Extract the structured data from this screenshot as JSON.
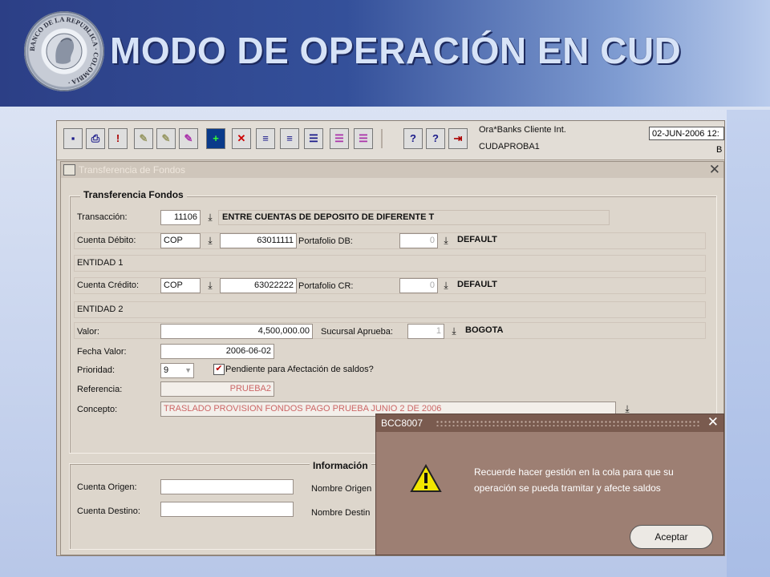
{
  "slide": {
    "title": "MODO DE OPERACIÓN EN CUD"
  },
  "logo": {
    "ring_text": "BANCO DE LA REPUBLICA · COLOMBIA ·"
  },
  "app": {
    "status": {
      "client": "Ora*Banks Cliente Int.",
      "user": "CUDAPROBA1",
      "date": "02-JUN-2006 12:",
      "suffix": "B"
    },
    "window": {
      "title": "Transferencia de Fondos",
      "section_title": "Transferencia Fondos",
      "fields": {
        "transaccion": {
          "label": "Transacción:",
          "code": "11106",
          "description": "ENTRE CUENTAS DE DEPOSITO DE DIFERENTE T"
        },
        "cuenta_debito": {
          "label": "Cuenta Débito:",
          "currency": "COP",
          "number": "63011111",
          "portfolio_label": "Portafolio DB:",
          "portfolio": "0",
          "portfolio_name": "DEFAULT"
        },
        "entidad1": "ENTIDAD 1",
        "cuenta_credito": {
          "label": "Cuenta Crédito:",
          "currency": "COP",
          "number": "63022222",
          "portfolio_label": "Portafolio CR:",
          "portfolio": "0",
          "portfolio_name": "DEFAULT"
        },
        "entidad2": "ENTIDAD 2",
        "valor": {
          "label": "Valor:",
          "value": "4,500,000.00",
          "branch_label": "Sucursal Aprueba:",
          "branch_code": "1",
          "branch_name": "BOGOTA"
        },
        "fecha_valor": {
          "label": "Fecha Valor:",
          "value": "2006-06-02"
        },
        "prioridad": {
          "label": "Prioridad:",
          "value": "9",
          "checkbox_label": "Pendiente para Afectación de saldos?",
          "checked": true
        },
        "referencia": {
          "label": "Referencia:",
          "value": "PRUEBA2"
        },
        "concepto": {
          "label": "Concepto:",
          "value": "TRASLADO PROVISION FONDOS PAGO PRUEBA JUNIO 2 DE 2006"
        }
      },
      "info_section": {
        "title": "Información",
        "cuenta_origen_label": "Cuenta Origen:",
        "cuenta_destino_label": "Cuenta Destino:",
        "nombre_origen_label": "Nombre Origen",
        "nombre_destino_label": "Nombre Destin"
      }
    }
  },
  "dialog": {
    "title": "BCC8007",
    "message_line1": "Recuerde hacer gestión en la cola para que su",
    "message_line2": "operación se pueda tramitar y afecte saldos",
    "button": "Aceptar",
    "icon": "warning-icon"
  },
  "toolbar_icons": [
    "save-icon",
    "print-icon",
    "print-alert-icon",
    "edit-icon",
    "edit2-icon",
    "edit3-icon",
    "add-record-icon",
    "delete-record-icon",
    "query-icon",
    "query2-icon",
    "list-icon",
    "list2-icon",
    "list3-icon",
    "help-icon",
    "question-icon",
    "exit-icon"
  ]
}
